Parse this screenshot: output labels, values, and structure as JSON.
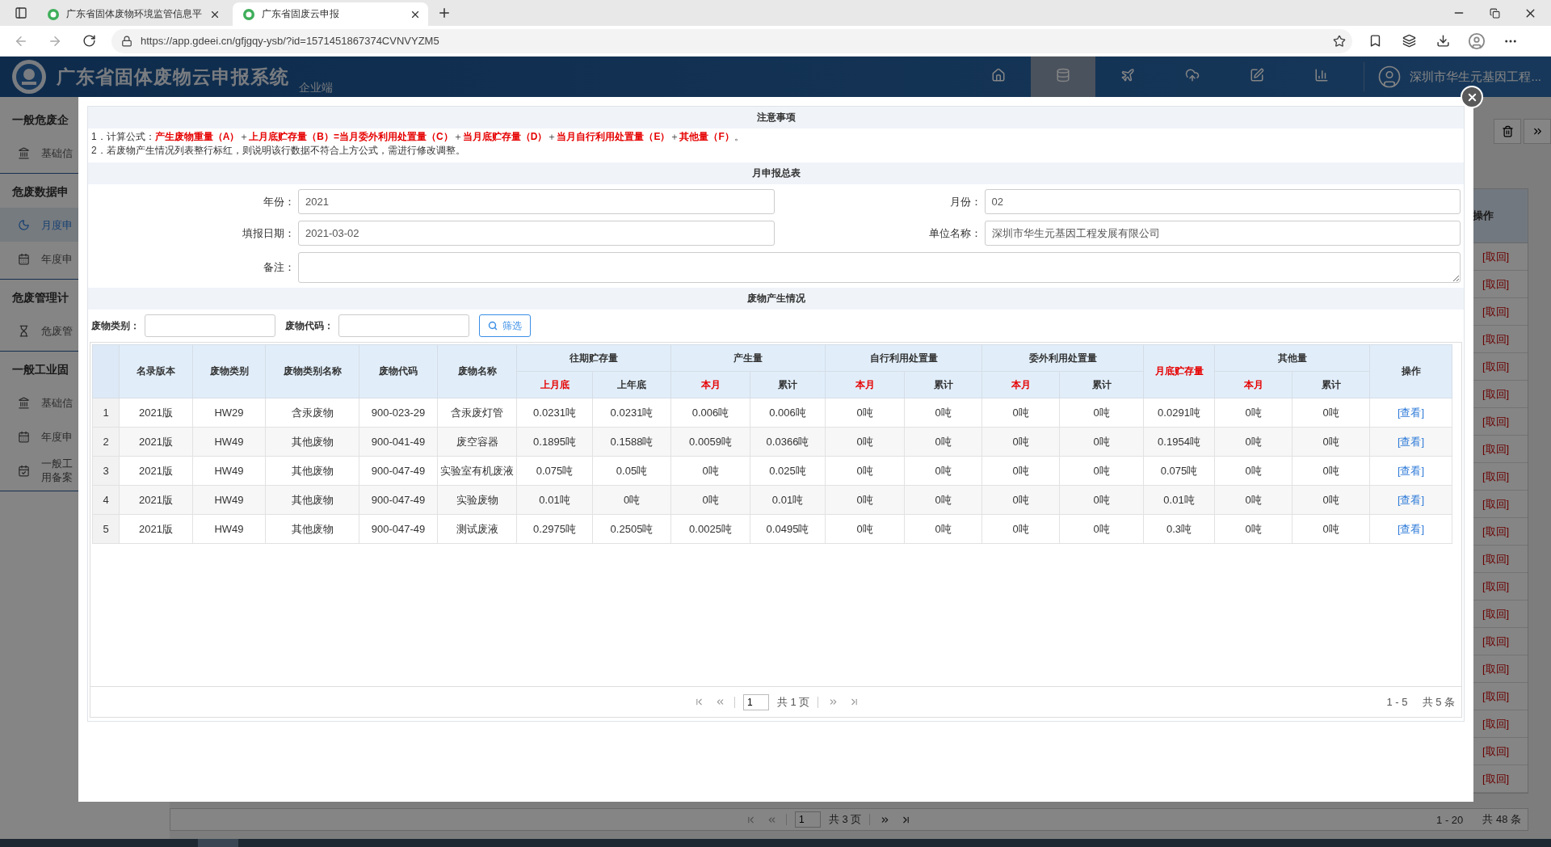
{
  "browser": {
    "tabs": [
      {
        "title": "广东省固体废物环境监管信息平",
        "selected": false
      },
      {
        "title": "广东省固废云申报",
        "selected": true
      }
    ],
    "url": "https://app.gdeei.cn/gfjgqy-ysb/?id=1571451867374CVNVYZM5"
  },
  "header": {
    "title": "广东省固体废物云申报系统",
    "subtitle": "企业端",
    "nav": [
      {
        "kind": "home",
        "selected": false
      },
      {
        "kind": "database",
        "selected": true
      },
      {
        "kind": "plane",
        "selected": false
      },
      {
        "kind": "upload",
        "selected": false
      },
      {
        "kind": "edit",
        "selected": false
      },
      {
        "kind": "chart",
        "selected": false
      }
    ],
    "user": "深圳市华生元基因工程..."
  },
  "sidebar": {
    "groups": [
      {
        "title": "一般危废企",
        "items": [
          {
            "kind": "bank",
            "lines": [
              "基础信"
            ],
            "selected": false
          }
        ]
      },
      {
        "title": "危废数据申",
        "items": [
          {
            "kind": "moon",
            "lines": [
              "月度申"
            ],
            "selected": true
          },
          {
            "kind": "calendar",
            "lines": [
              "年度申"
            ],
            "selected": false
          }
        ]
      },
      {
        "title": "危废管理计",
        "items": [
          {
            "kind": "hourglass",
            "lines": [
              "危废管"
            ],
            "selected": false
          }
        ]
      },
      {
        "title": "一般工业固",
        "items": [
          {
            "kind": "bank",
            "lines": [
              "基础信"
            ],
            "selected": false
          },
          {
            "kind": "calendar",
            "lines": [
              "年度申"
            ],
            "selected": false
          },
          {
            "kind": "check",
            "lines": [
              "一般工",
              "用备案"
            ],
            "selected": false
          }
        ]
      }
    ]
  },
  "background_list": {
    "header": "操作",
    "rows": [
      "[取回]",
      "[取回]",
      "[取回]",
      "[取回]",
      "[取回]",
      "[取回]",
      "[取回]",
      "[取回]",
      "[取回]",
      "[取回]",
      "[取回]",
      "[取回]",
      "[取回]",
      "[取回]",
      "[取回]",
      "[取回]",
      "[取回]",
      "[取回]",
      "[取回]",
      "[取回]"
    ],
    "pagination": {
      "page": "1",
      "total_pages": "共 3 页",
      "range": "1 - 20",
      "total": "共 48 条"
    }
  },
  "dialog": {
    "notes_title": "注意事项",
    "notes": [
      "1．计算公式：**产生废物重量（A）**＋**上月底贮存量（B）=当月委外利用处置量（C）**＋**当月底贮存量（D）**＋**当月自行利用处置量（E）**＋**其他量（F）**。",
      "2．若废物产生情况列表整行标红，则说明该行数据不符合上方公式，需进行修改调整。"
    ],
    "summary_title": "月申报总表",
    "fields": [
      {
        "label": "年份：",
        "value": "2021"
      },
      {
        "label": "月份：",
        "value": "02"
      },
      {
        "label": "填报日期：",
        "value": "2021-03-02"
      },
      {
        "label": "单位名称：",
        "value": "深圳市华生元基因工程发展有限公司"
      }
    ],
    "remark_label": "备注：",
    "waste_title": "废物产生情况",
    "filters": [
      {
        "label": "废物类别："
      },
      {
        "label": "废物代码："
      }
    ],
    "filter_button": "筛选",
    "columns": [
      {
        "kind": "row-number"
      },
      {
        "label": "名录版本",
        "highlight": false
      },
      {
        "label": "废物类别",
        "highlight": false
      },
      {
        "label": "废物类别名称",
        "highlight": false
      },
      {
        "label": "废物代码",
        "highlight": false
      },
      {
        "label": "废物名称",
        "highlight": false
      },
      {
        "label": "往期贮存量",
        "colspan": 2,
        "children": [
          {
            "label": "上月底",
            "highlight": true
          },
          {
            "label": "上年底",
            "highlight": false
          }
        ]
      },
      {
        "label": "产生量",
        "colspan": 2,
        "children": [
          {
            "label": "本月",
            "highlight": true
          },
          {
            "label": "累计",
            "highlight": false
          }
        ]
      },
      {
        "label": "自行利用处置量",
        "colspan": 2,
        "children": [
          {
            "label": "本月",
            "highlight": true
          },
          {
            "label": "累计",
            "highlight": false
          }
        ]
      },
      {
        "label": "委外利用处置量",
        "colspan": 2,
        "children": [
          {
            "label": "本月",
            "highlight": true
          },
          {
            "label": "累计",
            "highlight": false
          }
        ]
      },
      {
        "label": "月底贮存量",
        "highlight": true
      },
      {
        "label": "其他量",
        "colspan": 2,
        "children": [
          {
            "label": "本月",
            "highlight": true
          },
          {
            "label": "累计",
            "highlight": false
          }
        ]
      },
      {
        "label": "操作",
        "highlight": false
      }
    ],
    "rows": [
      {
        "cells": [
          "1",
          "2021版",
          "HW29",
          "含汞废物",
          "900-023-29",
          "含汞废灯管",
          "0.0231吨",
          "0.0231吨",
          "0.006吨",
          "0.006吨",
          "0吨",
          "0吨",
          "0吨",
          "0吨",
          "0.0291吨",
          "0吨",
          "0吨"
        ],
        "action": "[查看]"
      },
      {
        "cells": [
          "2",
          "2021版",
          "HW49",
          "其他废物",
          "900-041-49",
          "废空容器",
          "0.1895吨",
          "0.1588吨",
          "0.0059吨",
          "0.0366吨",
          "0吨",
          "0吨",
          "0吨",
          "0吨",
          "0.1954吨",
          "0吨",
          "0吨"
        ],
        "action": "[查看]"
      },
      {
        "cells": [
          "3",
          "2021版",
          "HW49",
          "其他废物",
          "900-047-49",
          "实验室有机废液",
          "0.075吨",
          "0.05吨",
          "0吨",
          "0.025吨",
          "0吨",
          "0吨",
          "0吨",
          "0吨",
          "0.075吨",
          "0吨",
          "0吨"
        ],
        "action": "[查看]"
      },
      {
        "cells": [
          "4",
          "2021版",
          "HW49",
          "其他废物",
          "900-047-49",
          "实验废物",
          "0.01吨",
          "0吨",
          "0吨",
          "0.01吨",
          "0吨",
          "0吨",
          "0吨",
          "0吨",
          "0.01吨",
          "0吨",
          "0吨"
        ],
        "action": "[查看]"
      },
      {
        "cells": [
          "5",
          "2021版",
          "HW49",
          "其他废物",
          "900-047-49",
          "测试废液",
          "0.2975吨",
          "0.2505吨",
          "0.0025吨",
          "0.0495吨",
          "0吨",
          "0吨",
          "0吨",
          "0吨",
          "0.3吨",
          "0吨",
          "0吨"
        ],
        "action": "[查看]"
      }
    ],
    "pagination": {
      "page": "1",
      "total_pages": "共 1 页",
      "range": "1 - 5",
      "total": "共 5 条"
    }
  }
}
